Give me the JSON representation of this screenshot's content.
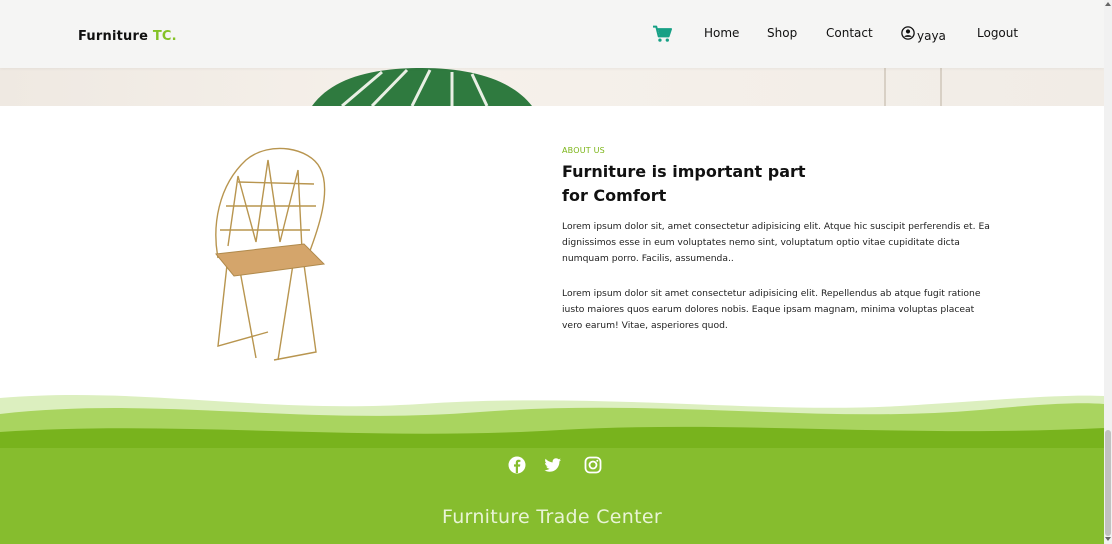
{
  "navbar": {
    "brand_main": "Furniture",
    "brand_accent": "TC.",
    "links": {
      "home": "Home",
      "shop": "Shop",
      "contact": "Contact",
      "user": "yaya",
      "logout": "Logout"
    },
    "icons": {
      "cart": "cart-icon",
      "user": "user-circle-icon"
    }
  },
  "about": {
    "eyebrow": "ABOUT US",
    "title_line1": "Furniture is important part",
    "title_line2": "for Comfort",
    "paragraph1": "Lorem ipsum dolor sit, amet consectetur adipisicing elit. Atque hic suscipit perferendis et. Ea dignissimos esse in eum voluptates nemo sint, voluptatum optio vitae cupiditate dicta numquam porro. Facilis, assumenda..",
    "paragraph2": "Lorem ipsum dolor sit amet consectetur adipisicing elit. Repellendus ab atque fugit ratione iusto maiores quos earum dolores nobis. Eaque ipsam magnam, minima voluptas placeat vero earum! Vitae, asperiores quod."
  },
  "footer": {
    "title": "Furniture Trade Center",
    "social": [
      "facebook-icon",
      "twitter-icon",
      "instagram-icon"
    ]
  },
  "colors": {
    "accent": "#84c225",
    "footer": "#86bd2e",
    "wave_dark": "#78b31d",
    "wave_light": "#b6dc74"
  }
}
